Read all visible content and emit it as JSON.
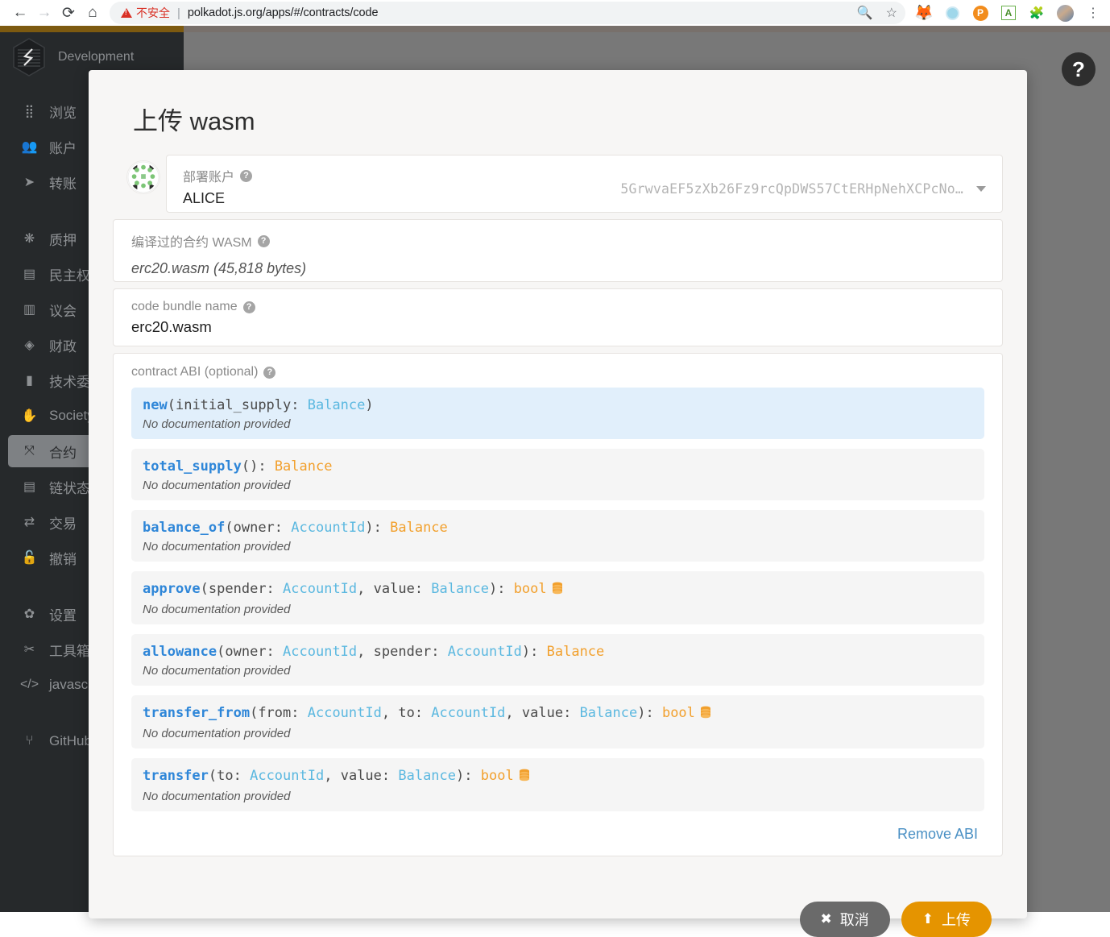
{
  "browser": {
    "back_icon": "back-arrow",
    "forward_icon": "forward-arrow",
    "reload_icon": "reload",
    "home_icon": "home",
    "security_label": "不安全",
    "url": "polkadot.js.org/apps/#/contracts/code",
    "zoom_icon": "zoom-search",
    "bookmark_icon": "star",
    "extensions": [
      {
        "name": "metamask-extension",
        "glyph": "🦊"
      },
      {
        "name": "circle-extension",
        "glyph": ""
      },
      {
        "name": "polkadot-extension",
        "glyph": "P"
      },
      {
        "name": "grammarly-extension",
        "glyph": "A"
      },
      {
        "name": "puzzle-extensions",
        "glyph": "🧩"
      },
      {
        "name": "profile-avatar",
        "glyph": ""
      }
    ],
    "menu_icon": "⋮"
  },
  "sidebar": {
    "brand": "Development",
    "items": [
      {
        "label": "浏览",
        "icon": "grid-dots-icon",
        "active": false
      },
      {
        "label": "账户",
        "icon": "users-icon",
        "active": false
      },
      {
        "label": "转账",
        "icon": "paper-plane-icon",
        "active": false
      },
      {
        "label": "质押",
        "icon": "certificate-icon",
        "active": false,
        "gap_before": true
      },
      {
        "label": "民主权",
        "icon": "calendar-check-icon",
        "active": false
      },
      {
        "label": "议会",
        "icon": "building-icon",
        "active": false
      },
      {
        "label": "财政",
        "icon": "gem-icon",
        "active": false
      },
      {
        "label": "技术委",
        "icon": "microchip-icon",
        "active": false
      },
      {
        "label": "Society",
        "icon": "hand-icon",
        "active": false
      },
      {
        "label": "合约",
        "icon": "compress-icon",
        "active": true
      },
      {
        "label": "链状态",
        "icon": "database-icon",
        "active": false
      },
      {
        "label": "交易",
        "icon": "exchange-icon",
        "active": false
      },
      {
        "label": "撤销",
        "icon": "unlock-icon",
        "active": false
      },
      {
        "label": "设置",
        "icon": "cogs-icon",
        "active": false,
        "gap_before": true
      },
      {
        "label": "工具箱",
        "icon": "tools-icon",
        "active": false
      },
      {
        "label": "javascript",
        "icon": "code-icon",
        "active": false
      },
      {
        "label": "GitHub",
        "icon": "code-branch-icon",
        "active": false,
        "gap_before": true
      }
    ]
  },
  "help_fab": {
    "icon": "question-mark-icon",
    "label": "?"
  },
  "modal": {
    "title": "上传 wasm",
    "account": {
      "label": "部署账户",
      "help": "?",
      "name": "ALICE",
      "address": "5GrwvaEF5zXb26Fz9rcQpDWS57CtERHpNehXCPcNo…",
      "caret_icon": "chevron-down-icon"
    },
    "wasm": {
      "label": "编译过的合约 WASM",
      "help": "?",
      "value": "erc20.wasm (45,818 bytes)"
    },
    "bundle": {
      "label": "code bundle name",
      "help": "?",
      "value": "erc20.wasm"
    },
    "abi": {
      "label": "contract ABI (optional)",
      "help": "?",
      "remove_label": "Remove ABI",
      "doc_placeholder": "No documentation provided",
      "entries": [
        {
          "constructor": true,
          "name": "new",
          "params": [
            {
              "name": "initial_supply",
              "type": "Balance"
            }
          ],
          "returns": null,
          "mutates": false,
          "doc": "No documentation provided"
        },
        {
          "constructor": false,
          "name": "total_supply",
          "params": [],
          "returns": "Balance",
          "mutates": false,
          "doc": "No documentation provided"
        },
        {
          "constructor": false,
          "name": "balance_of",
          "params": [
            {
              "name": "owner",
              "type": "AccountId"
            }
          ],
          "returns": "Balance",
          "mutates": false,
          "doc": "No documentation provided"
        },
        {
          "constructor": false,
          "name": "approve",
          "params": [
            {
              "name": "spender",
              "type": "AccountId"
            },
            {
              "name": "value",
              "type": "Balance"
            }
          ],
          "returns": "bool",
          "mutates": true,
          "doc": "No documentation provided"
        },
        {
          "constructor": false,
          "name": "allowance",
          "params": [
            {
              "name": "owner",
              "type": "AccountId"
            },
            {
              "name": "spender",
              "type": "AccountId"
            }
          ],
          "returns": "Balance",
          "mutates": false,
          "doc": "No documentation provided"
        },
        {
          "constructor": false,
          "name": "transfer_from",
          "params": [
            {
              "name": "from",
              "type": "AccountId"
            },
            {
              "name": "to",
              "type": "AccountId"
            },
            {
              "name": "value",
              "type": "Balance"
            }
          ],
          "returns": "bool",
          "mutates": true,
          "doc": "No documentation provided"
        },
        {
          "constructor": false,
          "name": "transfer",
          "params": [
            {
              "name": "to",
              "type": "AccountId"
            },
            {
              "name": "value",
              "type": "Balance"
            }
          ],
          "returns": "bool",
          "mutates": true,
          "doc": "No documentation provided"
        }
      ]
    },
    "buttons": {
      "cancel": {
        "label": "取消",
        "icon": "close-x-icon"
      },
      "upload": {
        "label": "上传",
        "icon": "upload-icon"
      }
    }
  },
  "colors": {
    "accent_orange": "#e59400",
    "fn_blue": "#2e86d8",
    "type_param": "#5bb8e0",
    "type_return": "#f2a02d",
    "ctor_bg": "#e1effb",
    "sidebar_bg": "#26292b",
    "overlay": "#787878"
  }
}
